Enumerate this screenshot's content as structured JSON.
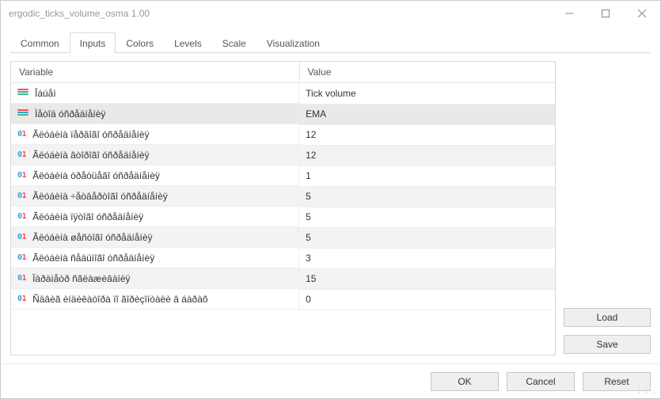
{
  "window": {
    "title": "ergodic_ticks_volume_osma 1.00",
    "buttons": {
      "minimize": "Minimize",
      "maximize": "Maximize",
      "close": "Close"
    }
  },
  "tabs": [
    {
      "id": "common",
      "label": "Common"
    },
    {
      "id": "inputs",
      "label": "Inputs"
    },
    {
      "id": "colors",
      "label": "Colors"
    },
    {
      "id": "levels",
      "label": "Levels"
    },
    {
      "id": "scale",
      "label": "Scale"
    },
    {
      "id": "visualization",
      "label": "Visualization"
    }
  ],
  "active_tab": "inputs",
  "columns": {
    "variable": "Variable",
    "value": "Value"
  },
  "rows": [
    {
      "icon": "enum",
      "variable": "Îáúåì",
      "value": "Tick volume",
      "alt": false
    },
    {
      "icon": "enum",
      "variable": "Ìåòîä óñðåäíåíèÿ",
      "value": "EMA",
      "alt": true,
      "selected": true
    },
    {
      "icon": "num",
      "variable": "Ãëóáèíà ïåðâîãî óñðåäíåíèÿ",
      "value": "12",
      "alt": false
    },
    {
      "icon": "num",
      "variable": "Ãëóáèíà âòîðîãî óñðåäíåíèÿ",
      "value": "12",
      "alt": true
    },
    {
      "icon": "num",
      "variable": "Ãëóáèíà òðåòüåãî óñðåäíåíèÿ",
      "value": "1",
      "alt": false
    },
    {
      "icon": "num",
      "variable": "Ãëóáèíà ÷åòâåðòîãî óñðåäíåíèÿ",
      "value": "5",
      "alt": true
    },
    {
      "icon": "num",
      "variable": "Ãëóáèíà ïÿòîãî óñðåäíåíèÿ",
      "value": "5",
      "alt": false
    },
    {
      "icon": "num",
      "variable": "Ãëóáèíà øåñòîãî óñðåäíåíèÿ",
      "value": "5",
      "alt": true
    },
    {
      "icon": "num",
      "variable": "Ãëóáèíà ñåäüìîãî óñðåäíåíèÿ",
      "value": "3",
      "alt": false
    },
    {
      "icon": "num",
      "variable": "Ïàðàìåòð ñãëàæèâàíèÿ",
      "value": "15",
      "alt": true
    },
    {
      "icon": "num",
      "variable": "Ñäâèã èíäèêàòîðà ïî ãîðèçîíòàëè â áàðàõ",
      "value": "0",
      "alt": false
    }
  ],
  "side_buttons": {
    "load": "Load",
    "save": "Save"
  },
  "footer_buttons": {
    "ok": "OK",
    "cancel": "Cancel",
    "reset": "Reset"
  }
}
